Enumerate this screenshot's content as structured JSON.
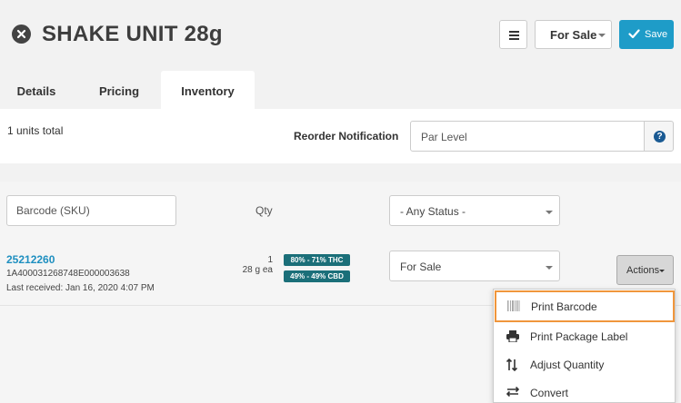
{
  "header": {
    "title": "SHAKE UNIT 28g",
    "status_selected": "For Sale",
    "save_label": "Save"
  },
  "tabs": [
    {
      "label": "Details",
      "active": false
    },
    {
      "label": "Pricing",
      "active": false
    },
    {
      "label": "Inventory",
      "active": true
    }
  ],
  "summary": {
    "units_total": "1 units total",
    "reorder_label": "Reorder Notification",
    "par_placeholder": "Par Level",
    "help_glyph": "?"
  },
  "filters": {
    "barcode_placeholder": "Barcode (SKU)",
    "qty_header": "Qty",
    "status_filter": "- Any Status -"
  },
  "row": {
    "sku": "25212260",
    "package_code": "1A400031268748E000003638",
    "last_received": "Last received: Jan 16, 2020 4:07 PM",
    "qty": "1",
    "unit": "28 g ea",
    "thc_badge": "80% - 71% THC",
    "cbd_badge": "49% - 49% CBD",
    "status": "For Sale",
    "actions_label": "Actions"
  },
  "actions_menu": [
    {
      "label": "Print Barcode",
      "icon": "barcode-icon",
      "highlighted": true
    },
    {
      "label": "Print Package Label",
      "icon": "printer-icon",
      "highlighted": false
    },
    {
      "label": "Adjust Quantity",
      "icon": "up-down-arrows-icon",
      "highlighted": false
    },
    {
      "label": "Convert",
      "icon": "swap-arrows-icon",
      "highlighted": false
    }
  ],
  "colors": {
    "accent": "#1e9cc8",
    "badge": "#1b6f79",
    "highlight_border": "#f0963c",
    "link": "#1e8fc0"
  }
}
